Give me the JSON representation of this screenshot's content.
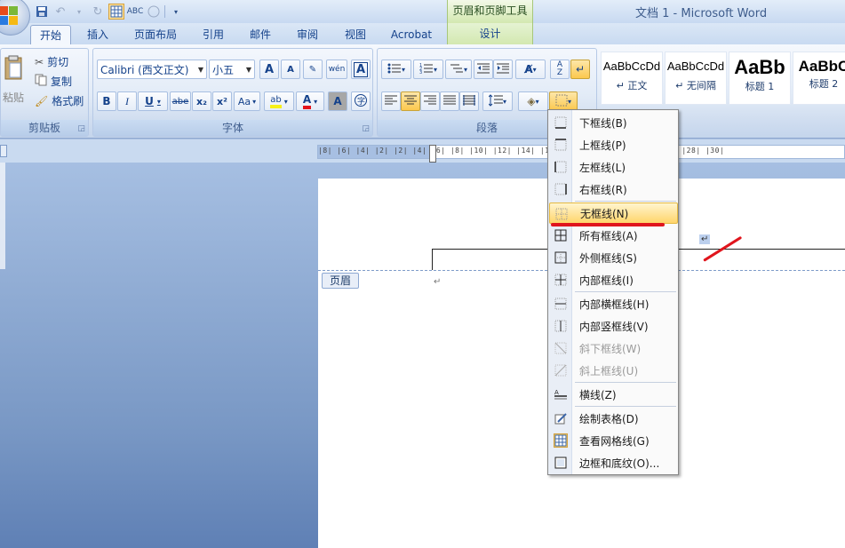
{
  "window": {
    "title": "文档 1 - Microsoft Word",
    "context_tool": "页眉和页脚工具"
  },
  "tabs": [
    "开始",
    "插入",
    "页面布局",
    "引用",
    "邮件",
    "审阅",
    "视图",
    "Acrobat",
    "设计"
  ],
  "clipboard": {
    "paste": "粘贴",
    "cut": "剪切",
    "copy": "复制",
    "format_painter": "格式刷",
    "label": "剪贴板"
  },
  "font": {
    "name": "Calibri (西文正文)",
    "size": "小五",
    "label": "字体",
    "grow": "A",
    "shrink": "A",
    "wen": "wén",
    "bold": "B",
    "italic": "I",
    "underline": "U",
    "strike": "abe",
    "sub": "x₂",
    "sup": "x²",
    "case": "Aa",
    "color": "A"
  },
  "paragraph": {
    "label": "段落"
  },
  "styles": [
    {
      "sample": "AaBbCcDd",
      "name": "↵ 正文"
    },
    {
      "sample": "AaBbCcDd",
      "name": "↵ 无间隔"
    },
    {
      "sample": "AaBb",
      "name": "标题 1"
    },
    {
      "sample": "AaBbC",
      "name": "标题 2"
    }
  ],
  "ruler": {
    "numbers": "|8| |6| |4| |2|    |2| |4| |6| |8| |10| |12| |14| |16| |18| |20| |22| |24| |26| |28| |30|"
  },
  "document": {
    "header_label": "页眉",
    "para_mark": "↵"
  },
  "menu": {
    "items": [
      {
        "label": "下框线(B)",
        "icon": "bottom-border-icon",
        "disabled": false
      },
      {
        "label": "上框线(P)",
        "icon": "top-border-icon",
        "disabled": false
      },
      {
        "label": "左框线(L)",
        "icon": "left-border-icon",
        "disabled": false
      },
      {
        "label": "右框线(R)",
        "icon": "right-border-icon",
        "disabled": false
      },
      {
        "label": "无框线(N)",
        "icon": "no-border-icon",
        "disabled": false,
        "highlighted": true
      },
      {
        "label": "所有框线(A)",
        "icon": "all-borders-icon",
        "disabled": false
      },
      {
        "label": "外侧框线(S)",
        "icon": "outside-borders-icon",
        "disabled": false
      },
      {
        "label": "内部框线(I)",
        "icon": "inside-borders-icon",
        "disabled": false
      },
      {
        "label": "内部横框线(H)",
        "icon": "inside-horizontal-border-icon",
        "disabled": false
      },
      {
        "label": "内部竖框线(V)",
        "icon": "inside-vertical-border-icon",
        "disabled": false
      },
      {
        "label": "斜下框线(W)",
        "icon": "diagonal-down-border-icon",
        "disabled": true
      },
      {
        "label": "斜上框线(U)",
        "icon": "diagonal-up-border-icon",
        "disabled": true
      },
      {
        "label": "横线(Z)",
        "icon": "horizontal-line-icon",
        "disabled": false
      },
      {
        "label": "绘制表格(D)",
        "icon": "draw-table-icon",
        "disabled": false
      },
      {
        "label": "查看网格线(G)",
        "icon": "view-gridlines-icon",
        "disabled": false,
        "checked": true
      },
      {
        "label": "边框和底纹(O)...",
        "icon": "borders-shading-icon",
        "disabled": false
      }
    ]
  },
  "colors": {
    "accent_highlight": "#ffd56b",
    "annotation_red": "#e0151d",
    "ribbon_text": "#15428b"
  }
}
